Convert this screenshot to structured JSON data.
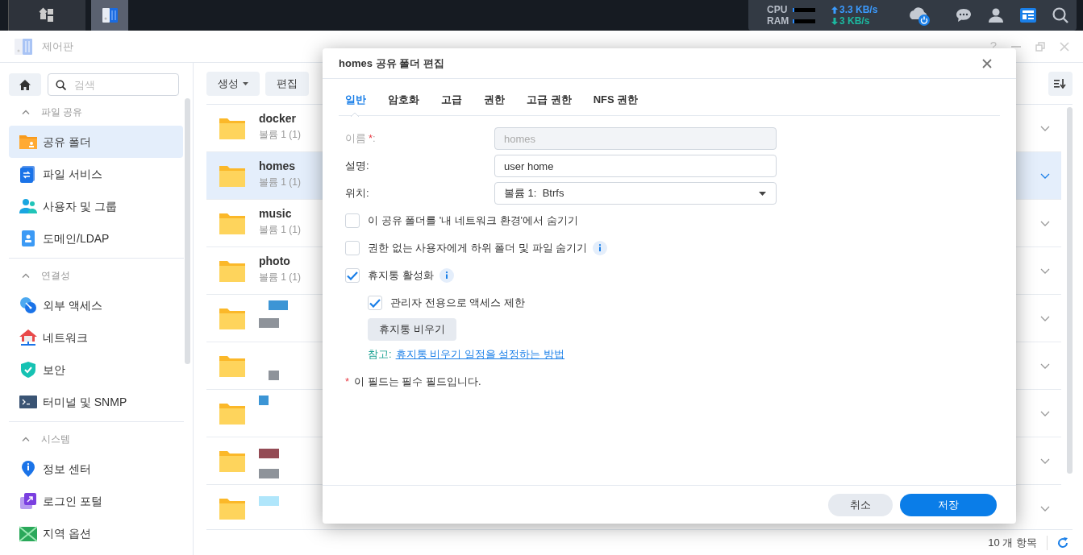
{
  "taskbar": {
    "apps": [
      {
        "kind": "grid",
        "selected": false
      },
      {
        "kind": "control-panel",
        "selected": true
      }
    ],
    "cpu_label": "CPU",
    "ram_label": "RAM",
    "upload": "3.3 KB/s",
    "download": "3 KB/s",
    "widgets_selected": true
  },
  "window": {
    "title": "제어판",
    "controls": [
      "?"
    ]
  },
  "sidebar": {
    "search": {
      "placeholder": "검색"
    },
    "sections": [
      {
        "title": "파일 공유",
        "expanded": true,
        "items": [
          {
            "label": "공유 폴더",
            "selected": true
          },
          {
            "label": "파일 서비스",
            "selected": false
          },
          {
            "label": "사용자 및 그룹",
            "selected": false
          },
          {
            "label": "도메인/LDAP",
            "selected": false
          }
        ]
      },
      {
        "title": "연결성",
        "expanded": true,
        "items": [
          {
            "label": "외부 액세스",
            "selected": false
          },
          {
            "label": "네트워크",
            "selected": false
          },
          {
            "label": "보안",
            "selected": false
          },
          {
            "label": "터미널 및 SNMP",
            "selected": false
          }
        ]
      },
      {
        "title": "시스템",
        "expanded": true,
        "items": [
          {
            "label": "정보 센터",
            "selected": false
          },
          {
            "label": "로그인 포털",
            "selected": false
          },
          {
            "label": "지역 옵션",
            "selected": false
          }
        ]
      }
    ]
  },
  "toolbar": {
    "buttons": [
      "생성",
      "편집"
    ]
  },
  "folders": [
    {
      "name": "docker",
      "volume": "볼륨 1 (1)",
      "selected": false
    },
    {
      "name": "homes",
      "volume": "볼륨 1 (1)",
      "selected": true
    },
    {
      "name": "music",
      "volume": "볼륨 1 (1)",
      "selected": false
    },
    {
      "name": "photo",
      "volume": "볼륨 1 (1)",
      "selected": false
    },
    {
      "selected": false
    },
    {
      "selected": false
    },
    {
      "selected": false
    },
    {
      "selected": false
    },
    {
      "selected": false
    }
  ],
  "status_bar": {
    "count": "10 개 항목"
  },
  "dialog": {
    "title": "homes 공유 폴더 편집",
    "tabs": [
      {
        "label": "일반",
        "selected": true
      },
      {
        "label": "암호화",
        "selected": false
      },
      {
        "label": "고급",
        "selected": false
      },
      {
        "label": "권한",
        "selected": false
      },
      {
        "label": "고급 권한",
        "selected": false
      },
      {
        "label": "NFS 권한",
        "selected": false
      }
    ],
    "fields": [
      {
        "kind": "text",
        "label": "이름",
        "required": true,
        "label_end": ":",
        "value": "homes",
        "disabled": true
      },
      {
        "kind": "text",
        "label": "설명:",
        "required": false,
        "value": "user home",
        "disabled": false
      },
      {
        "kind": "select",
        "label": "위치:",
        "required": false,
        "value": "볼륨 1:  Btrfs"
      }
    ],
    "options": [
      {
        "label": "이 공유 폴더를 '내 네트워크 환경'에서 숨기기",
        "checked": false,
        "info": false
      },
      {
        "label": "권한 없는 사용자에게 하위 폴더 및 파일 숨기기",
        "checked": false,
        "info": true
      },
      {
        "label": "휴지통 활성화",
        "checked": true,
        "info": true,
        "children": [
          {
            "label": "관리자 전용으로 액세스 제한",
            "checked": true,
            "info": false
          }
        ]
      }
    ],
    "action_button": "휴지통 비우기",
    "note_label": "참고:",
    "note_link": "휴지통 비우기 일정을 설정하는 방법",
    "required_mark": "*",
    "required_note": "이 필드는 필수 필드입니다.",
    "buttons": [
      {
        "label": "취소",
        "kind": "secondary"
      },
      {
        "label": "저장",
        "kind": "primary"
      }
    ]
  }
}
